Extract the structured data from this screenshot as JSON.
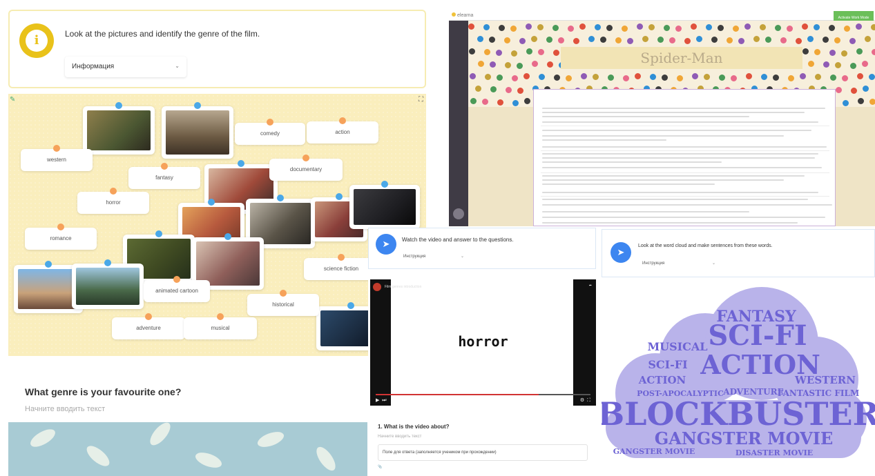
{
  "left": {
    "task": {
      "instruction": "Look at the pictures and identify the genre of the film.",
      "dropdown_value": "Информация",
      "icon": "info-icon"
    },
    "board": {
      "labels": [
        "western",
        "fantasy",
        "horror",
        "romance",
        "comedy",
        "action",
        "documentary",
        "science fiction",
        "animated cartoon",
        "historical",
        "adventure",
        "musical"
      ]
    },
    "question": {
      "title": "What genre is your favourite one?",
      "placeholder": "Начните вводить текст"
    }
  },
  "spider": {
    "title": "Spider-Man",
    "toolbar_button": "Activate Work Mode"
  },
  "video_panel": {
    "instruction": "Watch the video and answer to the questions.",
    "dropdown_value": "Инструкция",
    "video_genre_word": "horror",
    "progress": 0.76,
    "question": "1. What is the video about?",
    "answer_placeholder": "Начните вводить текст",
    "answer_value": "Поле для ответа (заполняется учеником при прохождении)"
  },
  "cloud_panel": {
    "instruction": "Look at the word cloud and make sentences from these words.",
    "dropdown_value": "Инструкция",
    "words": {
      "fantasy": "FANTASY",
      "scifi": "SCI-FI",
      "musical": "MUSICAL",
      "action": "ACTION",
      "western": "WESTERN",
      "postapoc": "POST-APOCALYPTIC",
      "adventure": "ADVENTURE",
      "fantastic_film": "FANTASTIC FILM",
      "blockbuster": "BLOCKBUSTER",
      "gangster_movie": "GANGSTER MOVIE",
      "disaster_movie": "DISASTER MOVIE"
    },
    "colors": {
      "cloud": "#b9b3ea",
      "text": "#6d63d4"
    }
  }
}
